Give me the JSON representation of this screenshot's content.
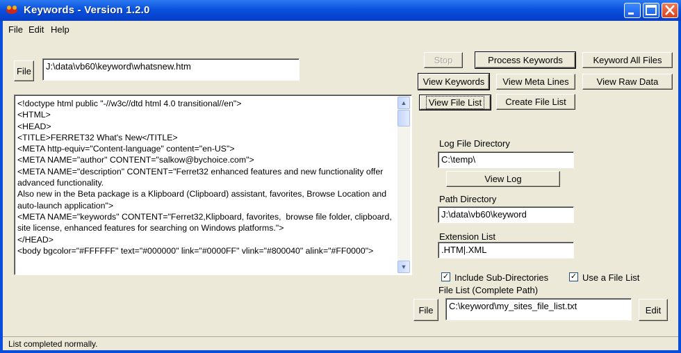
{
  "window": {
    "title": "Keywords -  Version 1.2.0"
  },
  "menu": {
    "file": "File",
    "edit": "Edit",
    "help": "Help"
  },
  "top": {
    "file_button": "File",
    "file_path": "J:\\data\\vb60\\keyword\\whatsnew.htm"
  },
  "buttons": {
    "stop": "Stop",
    "process_keywords": "Process Keywords",
    "keyword_all_files": "Keyword All Files",
    "view_keywords": "View Keywords",
    "view_meta_lines": "View Meta Lines",
    "view_raw_data": "View Raw Data",
    "view_file_list": "View File List",
    "create_file_list": "Create File List",
    "view_log": "View Log",
    "file_list_file": "File",
    "edit": "Edit"
  },
  "text_lines": [
    "<!doctype html public \"-//w3c//dtd html 4.0 transitional//en\">",
    "<HTML>",
    "<HEAD>",
    "<TITLE>FERRET32 What's New</TITLE>",
    "<META http-equiv=\"Content-language\" content=\"en-US\">",
    "<META NAME=\"author\" CONTENT=\"salkow@bychoice.com\">",
    "<META NAME=\"description\" CONTENT=\"Ferret32 enhanced features and new functionality offer advanced functionality.",
    "Also new in the Beta package is a Klipboard (Clipboard) assistant, favorites, Browse Location and auto-launch application\">",
    "<META NAME=\"keywords\" CONTENT=\"Ferret32,Klipboard, favorites,  browse file folder, clipboard, site license, enhanced features for searching on Windows platforms.\">",
    "</HEAD>",
    "<body bgcolor=\"#FFFFFF\" text=\"#000000\" link=\"#0000FF\" vlink=\"#800040\" alink=\"#FF0000\">"
  ],
  "log": {
    "label": "Log File Directory",
    "value": "C:\\temp\\"
  },
  "path": {
    "label": "Path Directory",
    "value": "J:\\data\\vb60\\keyword"
  },
  "extension": {
    "label": "Extension List",
    "value": ".HTM|.XML"
  },
  "options": {
    "include_sub_dirs": {
      "label": "Include Sub-Directories",
      "checked": true
    },
    "use_file_list": {
      "label": "Use a File List",
      "checked": true
    }
  },
  "file_list": {
    "label": "File List (Complete Path)",
    "value": "C:\\keyword\\my_sites_file_list.txt"
  },
  "status": "List completed normally.",
  "colors": {
    "titlebar": "#0a52dc",
    "face": "#ece9d8"
  },
  "icons": {
    "app": "app-icon",
    "minimize": "minimize-icon",
    "maximize": "maximize-icon",
    "close": "close-icon"
  }
}
